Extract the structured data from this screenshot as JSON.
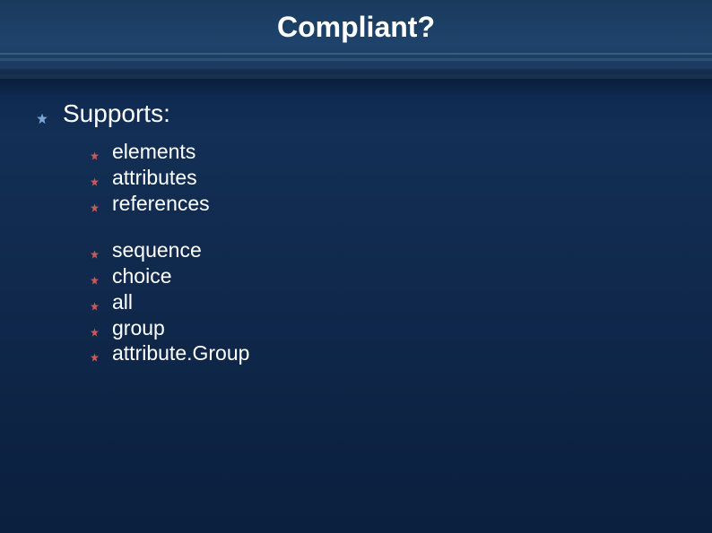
{
  "title": "Compliant?",
  "main": {
    "label": "Supports:",
    "groups": [
      {
        "items": [
          "elements",
          "attributes",
          "references"
        ]
      },
      {
        "items": [
          "sequence",
          "choice",
          "all",
          "group",
          "attribute.Group"
        ]
      }
    ]
  }
}
